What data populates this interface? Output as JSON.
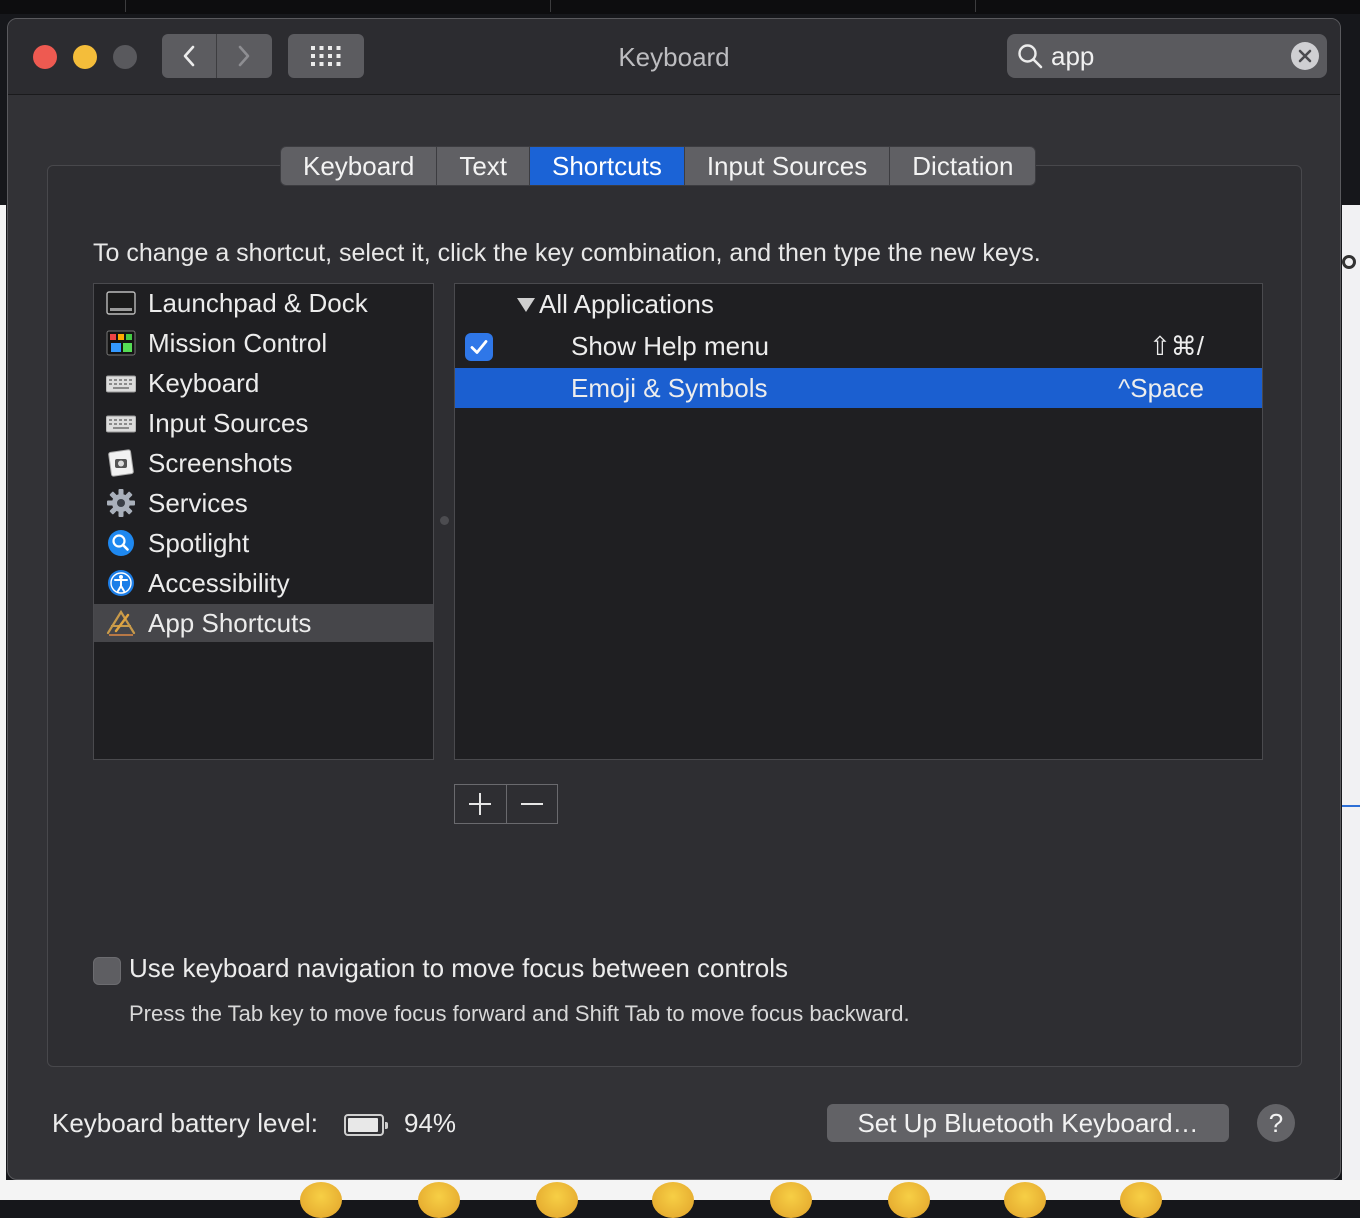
{
  "window": {
    "title": "Keyboard"
  },
  "search": {
    "value": "app"
  },
  "tabs": [
    {
      "label": "Keyboard",
      "active": false
    },
    {
      "label": "Text",
      "active": false
    },
    {
      "label": "Shortcuts",
      "active": true
    },
    {
      "label": "Input Sources",
      "active": false
    },
    {
      "label": "Dictation",
      "active": false
    }
  ],
  "instruction": "To change a shortcut, select it, click the key combination, and then type the new keys.",
  "categories": [
    {
      "label": "Launchpad & Dock",
      "icon": "launchpad-dock-icon"
    },
    {
      "label": "Mission Control",
      "icon": "mission-control-icon"
    },
    {
      "label": "Keyboard",
      "icon": "keyboard-icon"
    },
    {
      "label": "Input Sources",
      "icon": "input-sources-icon"
    },
    {
      "label": "Screenshots",
      "icon": "screenshots-icon"
    },
    {
      "label": "Services",
      "icon": "services-gear-icon"
    },
    {
      "label": "Spotlight",
      "icon": "spotlight-icon"
    },
    {
      "label": "Accessibility",
      "icon": "accessibility-icon"
    },
    {
      "label": "App Shortcuts",
      "icon": "app-shortcuts-icon",
      "selected": true
    }
  ],
  "shortcuts": {
    "group": "All Applications",
    "items": [
      {
        "name": "Show Help menu",
        "keys": "⇧⌘/",
        "checked": true,
        "selected": false
      },
      {
        "name": "Emoji & Symbols",
        "keys": "^Space",
        "checked": false,
        "selected": true
      }
    ]
  },
  "keyboard_navigation": {
    "label": "Use keyboard navigation to move focus between controls",
    "checked": false,
    "help": "Press the Tab key to move focus forward and Shift Tab to move focus backward."
  },
  "battery": {
    "label": "Keyboard battery level:",
    "percent_text": "94%",
    "level": 0.94
  },
  "buttons": {
    "bluetooth": "Set Up Bluetooth Keyboard…",
    "help": "?"
  },
  "colors": {
    "accent": "#1b63d6",
    "selection": "#1b5fd0",
    "window": "#323236"
  }
}
